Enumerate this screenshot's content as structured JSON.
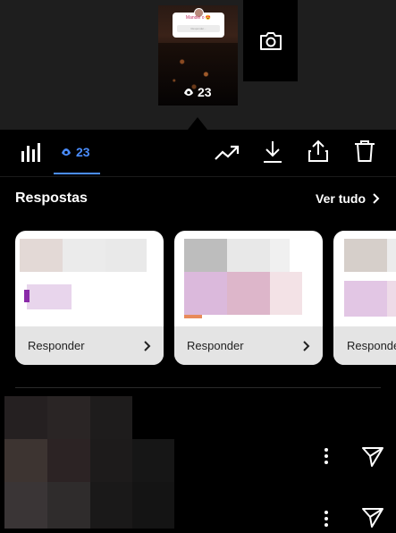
{
  "story": {
    "card_title": "Mandei o 😍",
    "card_hint": "Responder...",
    "views": "23"
  },
  "toolbar": {
    "viewers_count": "23"
  },
  "responses": {
    "title": "Respostas",
    "see_all": "Ver tudo",
    "cards": [
      {
        "reply_label": "Responder"
      },
      {
        "reply_label": "Responder"
      },
      {
        "reply_label": "Responde"
      }
    ]
  },
  "colors": {
    "accent": "#4a8dff",
    "background": "#000000",
    "top_panel": "#1e1e1e"
  }
}
